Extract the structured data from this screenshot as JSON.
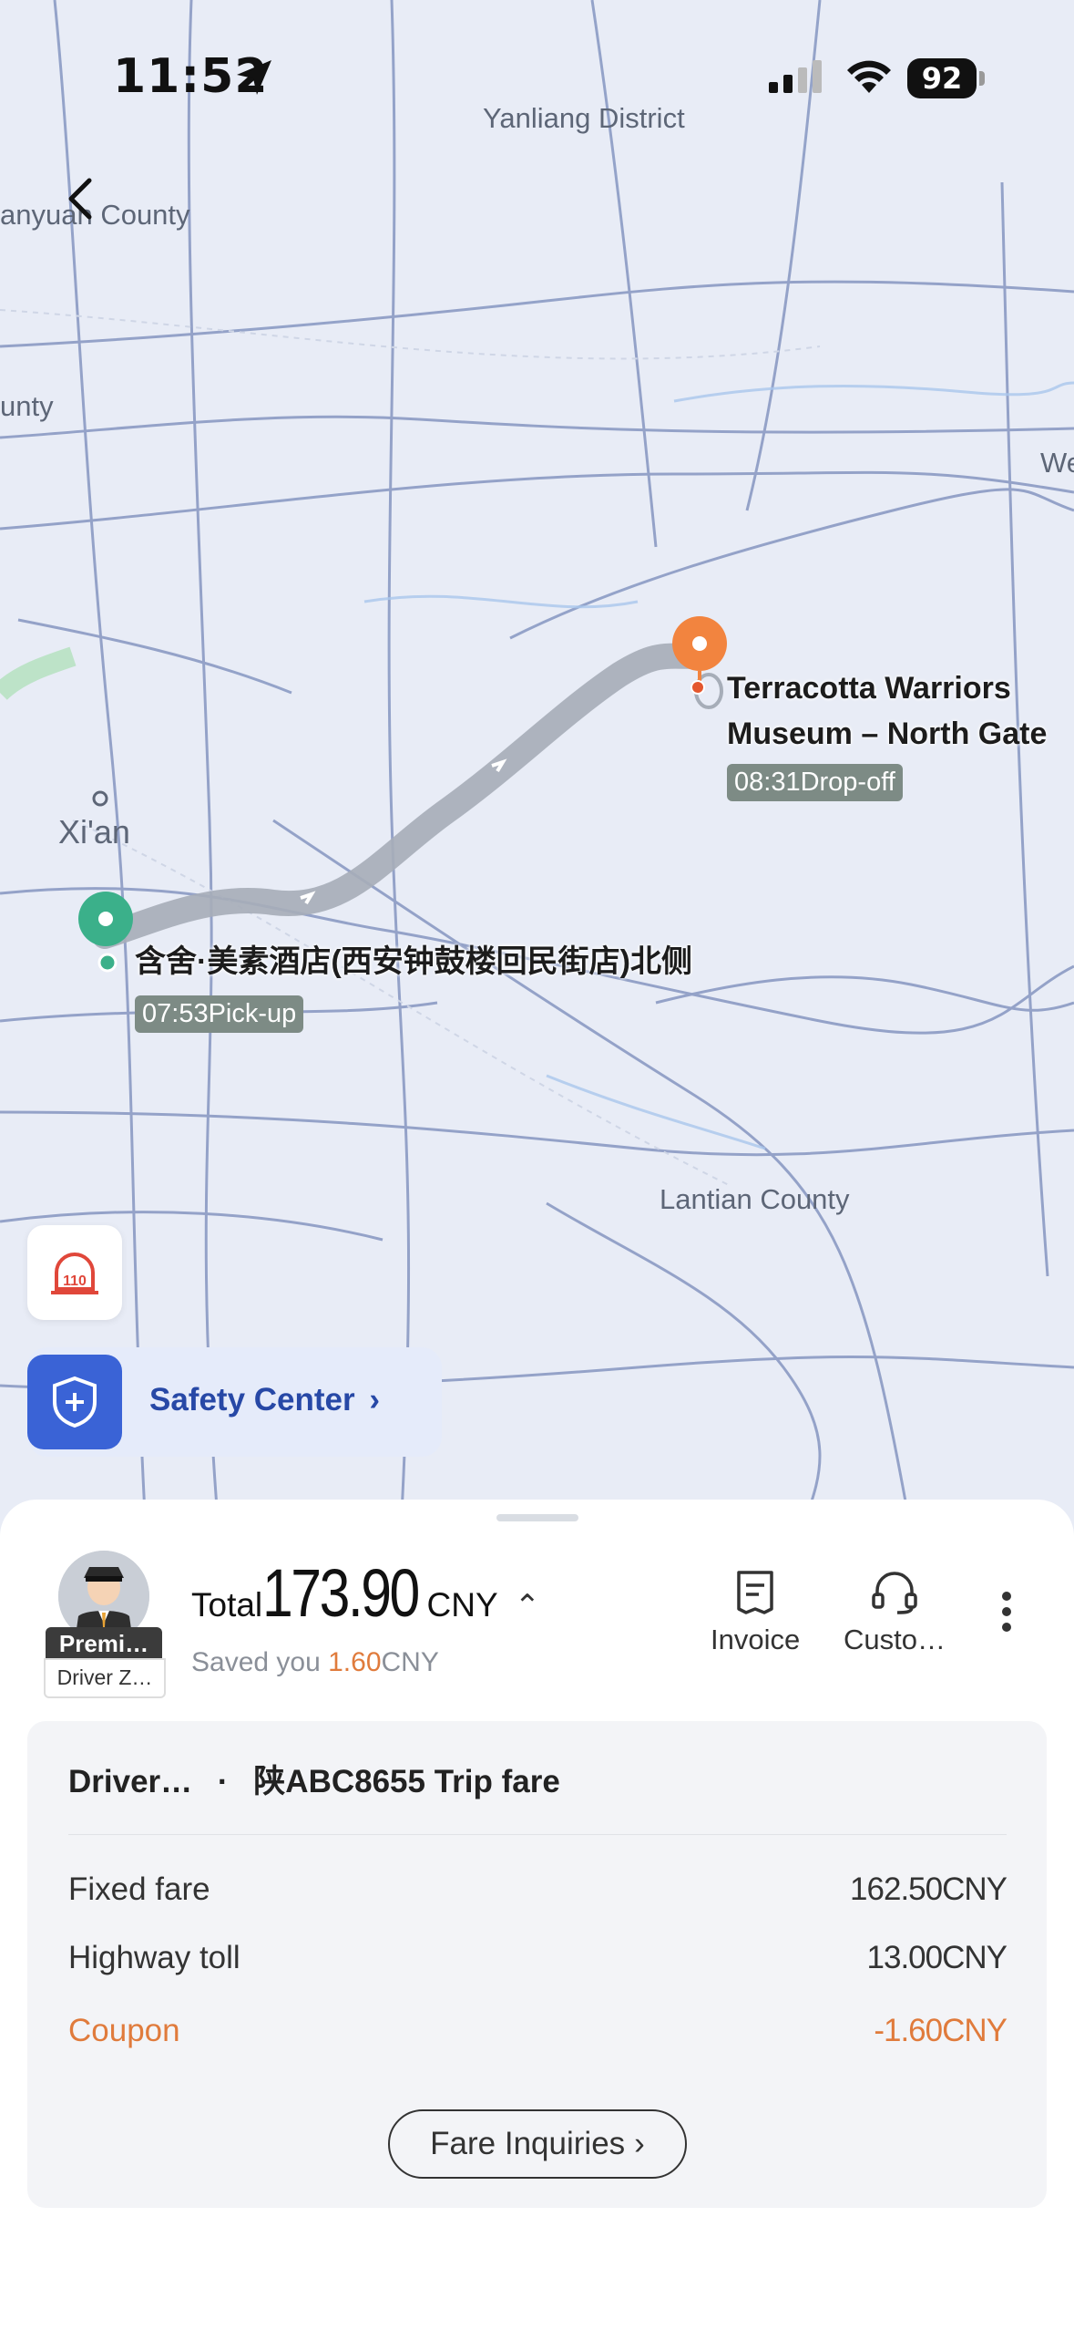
{
  "status_bar": {
    "time": "11:52",
    "battery": "92"
  },
  "map": {
    "places": {
      "yanliang": "Yanliang District",
      "sanyuan": "anyuan County",
      "unty": "unty",
      "we": "We",
      "xian": "Xi'an",
      "lantian": "Lantian County"
    },
    "dropoff": {
      "name_line1": "Terracotta Warriors",
      "name_line2": "Museum – North Gate",
      "time_tag": "08:31Drop-off"
    },
    "pickup": {
      "name": "含舍·美素酒店(西安钟鼓楼回民街店)北侧",
      "time_tag": "07:53Pick-up"
    }
  },
  "sos_label": "110",
  "safety_center": {
    "label": "Safety Center"
  },
  "trip": {
    "badge": "Premi…",
    "driver_tag": "Driver Z…",
    "total_label": "Total",
    "total_amount": "173.90",
    "currency": "CNY",
    "saved_prefix": "Saved you ",
    "saved_amount": "1.60",
    "saved_suffix": "CNY",
    "actions": {
      "invoice": "Invoice",
      "customer": "Custo…"
    }
  },
  "fare": {
    "title_driver": "Driver…",
    "title_dot": "·",
    "title_plate": "陕ABC8655",
    "title_suffix": "Trip fare",
    "rows": [
      {
        "label": "Fixed fare",
        "value": "162.50CNY"
      },
      {
        "label": "Highway toll",
        "value": "13.00CNY"
      },
      {
        "label": "Coupon",
        "value": "-1.60CNY"
      }
    ],
    "inquiries": "Fare Inquiries"
  },
  "colors": {
    "accent_orange": "#e07b3c",
    "pickup_green": "#3bb08a",
    "safety_blue": "#3a63d6"
  }
}
